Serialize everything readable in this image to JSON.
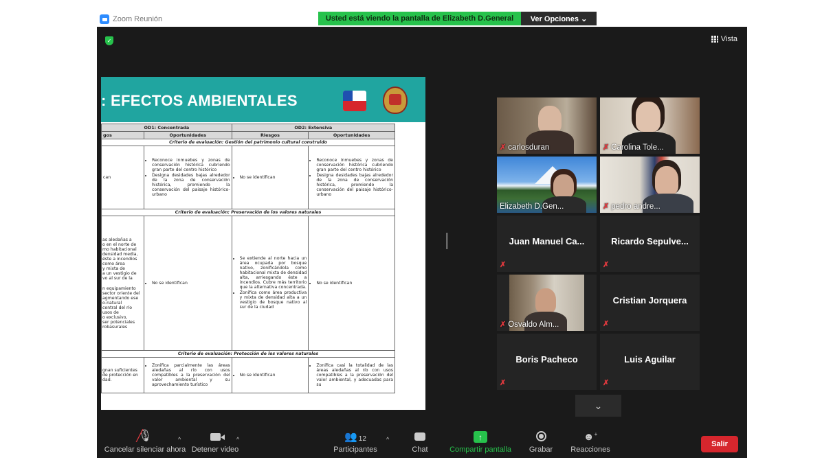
{
  "app": {
    "title": "Zoom Reunión"
  },
  "banner": {
    "sharing_text": "Usted está viendo la pantalla de Elizabeth D.General",
    "view_options": "Ver Opciones ⌄"
  },
  "view": {
    "label": "Vista"
  },
  "slide": {
    "title": ": EFECTOS AMBIENTALES",
    "headers": {
      "od1": "OD1: Concentrada",
      "od2": "OD2: Extensiva",
      "riesgos_cut": "gos",
      "oportunidades": "Oportunidades",
      "riesgos": "Riesgos"
    },
    "criteria": [
      "Criterio de evaluación: Gestión del patrimonio cultural construido",
      "Criterio de evaluación: Preservación de los valores naturales",
      "Criterio de evaluación: Protección de los valores naturales"
    ],
    "row1": {
      "c1": "can",
      "c2": [
        "Reconoce inmuebes y zonas de conservación histórica cubriendo gran parte del centro histórico",
        "Designa desidades bajas alrededor de la zona de conservación histórica, promiendo la conservación del paisaje histórico-urbano"
      ],
      "c3": "No se identifican",
      "c4": [
        "Reconoce inmuebes y zonas de conservación histórica cubriendo gran parte del centro histórico",
        "Designa desidades bajas alrededor de la zona de conservación histórica, promiendo la conservación del paisaje histórico-urbano"
      ]
    },
    "row2": {
      "c1": [
        "as aledañas a",
        "o en el norte de",
        "mo habitacional",
        "densidad media,",
        "éste a incendios",
        "como área",
        "y mixta de",
        "a un vestigio de",
        "vo al sur de la",
        "",
        "n equipamiento",
        "sector oriente del",
        "agmentando ese",
        "o-natural",
        "central del río",
        "usos de",
        "o exclusivo,",
        "ser potenciales",
        "robasurales"
      ],
      "c2": "No se identifican",
      "c3": [
        "Se extiende al norte hacia un área ocupada por bosque nativo, zonificándola como habitacional mixta de densidad alta, arriesgando éste a incendios. Cubre más territorio que la alternativa concentrada.",
        "Zonifica como área productiva y mixta de densidad alta a un vestigio de bosque nativo al sur de la ciudad"
      ],
      "c4": "No se identifican"
    },
    "row3": {
      "c1": [
        "gnan suficientes",
        "de protección en",
        "dad."
      ],
      "c2": [
        "Zonifica parcialmente las áreas aledañas al río con usos compatibles a la preservación del valor ambiental y su aprovechamiento turístico"
      ],
      "c3": "No se identifican",
      "c4": [
        "Zonifica casi la totalidad de las áreas aledañas al río con usos compatibles a la preservación del valor ambiental, y adecuadas para su"
      ]
    }
  },
  "participants": [
    {
      "name": "carlosduran",
      "video": true
    },
    {
      "name": "Carolina Tole...",
      "video": true
    },
    {
      "name": "Elizabeth D.Gen...",
      "video": true,
      "active": true
    },
    {
      "name": "pedro andre...",
      "video": true
    },
    {
      "name": "Juan Manuel Ca...",
      "video": false
    },
    {
      "name": "Ricardo Sepulve...",
      "video": false
    },
    {
      "name": "Osvaldo Alm...",
      "video": true
    },
    {
      "name": "Cristian Jorquera",
      "video": false
    },
    {
      "name": "Boris Pacheco",
      "video": false
    },
    {
      "name": "Luis Aguilar",
      "video": false
    }
  ],
  "toolbar": {
    "unmute": "Cancelar silenciar ahora",
    "stop_video": "Detener video",
    "participants": "Participantes",
    "participants_count": "12",
    "chat": "Chat",
    "share": "Compartir pantalla",
    "record": "Grabar",
    "reactions": "Reacciones",
    "leave": "Salir"
  },
  "colors": {
    "accent_green": "#27c24c",
    "active_speaker": "#d7e36a",
    "leave_red": "#d6262d",
    "slide_teal": "#20a5a0"
  }
}
